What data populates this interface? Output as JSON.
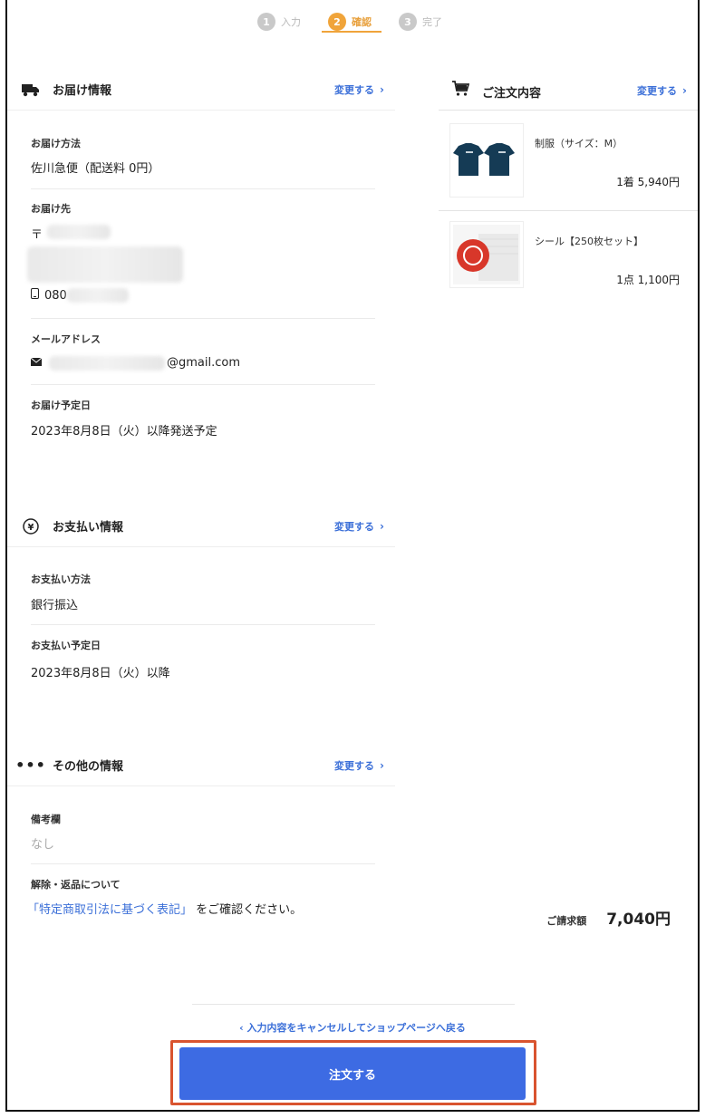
{
  "stepper": {
    "steps": [
      {
        "num": "1",
        "label": "入力"
      },
      {
        "num": "2",
        "label": "確認"
      },
      {
        "num": "3",
        "label": "完了"
      }
    ]
  },
  "delivery": {
    "title": "お届け情報",
    "change_label": "変更する",
    "method_label": "お届け方法",
    "method_value": "佐川急便（配送料 0円）",
    "address_label": "お届け先",
    "postal_prefix": "〒",
    "phone_prefix": "080",
    "email_label": "メールアドレス",
    "email_suffix": "@gmail.com",
    "date_label": "お届け予定日",
    "date_value": "2023年8月8日（火）以降発送予定"
  },
  "payment": {
    "title": "お支払い情報",
    "change_label": "変更する",
    "method_label": "お支払い方法",
    "method_value": "銀行振込",
    "date_label": "お支払い予定日",
    "date_value": "2023年8月8日（火）以降"
  },
  "other": {
    "title": "その他の情報",
    "change_label": "変更する",
    "remarks_label": "備考欄",
    "remarks_value": "なし",
    "cancel_label": "解除・返品について",
    "cancel_link": "「特定商取引法に基づく表記」",
    "cancel_text": "をご確認ください。"
  },
  "cart": {
    "title": "ご注文内容",
    "change_label": "変更する",
    "items": [
      {
        "name": "制服（サイズ：M）",
        "qty": "1着  5,940円"
      },
      {
        "name": "シール【250枚セット】",
        "qty": "1点  1,100円"
      }
    ],
    "total_label": "ご請求額",
    "total_value": "7,040円"
  },
  "footer": {
    "back_link": "入力内容をキャンセルしてショップページへ戻る",
    "order_button": "注文する"
  },
  "colors": {
    "accent": "#3d6be3",
    "step_active": "#f0a43a",
    "highlight": "#d9542f"
  }
}
